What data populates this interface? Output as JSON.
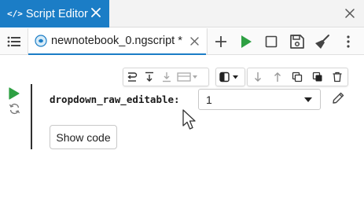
{
  "window": {
    "tab_title": "Script Editor",
    "tab_icon": "code-icon",
    "tab_color": "#1b7dc6"
  },
  "editor": {
    "file_tab": {
      "name": "newnotebook_0.ngscript *",
      "icon": "notebook-file-icon"
    },
    "toolbar": {
      "add_icon": "plus-icon",
      "run_icon": "play-icon",
      "stop_icon": "stop-icon",
      "save_icon": "save-icon",
      "clean_icon": "broom-icon",
      "more_icon": "more-vertical-icon"
    }
  },
  "cell": {
    "field_label": "dropdown_raw_editable:",
    "dropdown_value": "1",
    "show_code_label": "Show code",
    "run_color": "#2ea043"
  }
}
